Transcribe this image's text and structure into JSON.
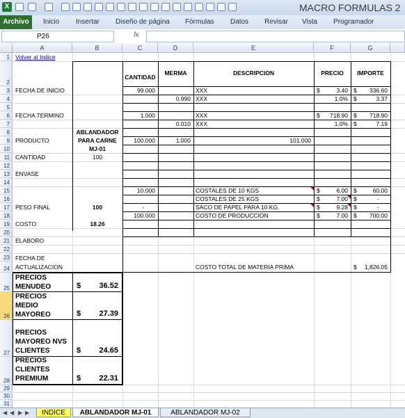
{
  "window": {
    "title": "MACRO FORMULAS 2"
  },
  "ribbon": {
    "tabs": [
      "Archivo",
      "Inicio",
      "Insertar",
      "Diseño de página",
      "Fórmulas",
      "Datos",
      "Revisar",
      "Vista",
      "Programador"
    ]
  },
  "formula_bar": {
    "name_box": "P26",
    "fx": "fx",
    "content": ""
  },
  "columns": [
    "A",
    "B",
    "C",
    "D",
    "E",
    "F",
    "G"
  ],
  "rows": [
    "1",
    "2",
    "3",
    "4",
    "5",
    "6",
    "7",
    "8",
    "9",
    "10",
    "11",
    "12",
    "13",
    "14",
    "15",
    "16",
    "17",
    "18",
    "19",
    "20",
    "21",
    "22",
    "23",
    "24",
    "25",
    "26",
    "27",
    "28",
    "29",
    "30",
    "31"
  ],
  "sheet": {
    "link": "Volver al Indice",
    "headers": {
      "cantidad": "CANTIDAD",
      "merma": "MERMA",
      "descripcion": "DESCRIPCION",
      "precio": "PRECIO",
      "importe": "IMPORTE"
    },
    "labels": {
      "fecha_inicio": "FECHA DE INICIO",
      "fecha_termino": "FECHA  TERMINO",
      "producto": "PRODUCTO",
      "cantidad": "CANTIDAD",
      "envase": "ENVASE",
      "peso_final": "PESO FINAL",
      "costo": "COSTO",
      "elaboro": "ELABORO",
      "fecha_de": "FECHA DE",
      "actualizacion": "ACTUALIZACION"
    },
    "producto_name_1": "ABLANDADOR",
    "producto_name_2": "PARA CARNE",
    "producto_code": "MJ-01",
    "cantidad_val": "100",
    "peso_final_val": "100",
    "costo_val": "18.26",
    "r3": {
      "c": "99.000",
      "e": "XXX",
      "f_sym": "$",
      "f": "3.40",
      "g_sym": "$",
      "g": "336.60"
    },
    "r4": {
      "d": "0.990",
      "e": "XXX",
      "f": "1.0%",
      "g_sym": "$",
      "g": "3.37"
    },
    "r6": {
      "c": "1.000",
      "e": "XXX",
      "f_sym": "$",
      "f": "718.90",
      "g_sym": "$",
      "g": "718.90"
    },
    "r7": {
      "d": "0.010",
      "e": "XXX",
      "f": "1.0%",
      "g_sym": "$",
      "g": "7.19"
    },
    "r9": {
      "c": "100.000",
      "d": "1.000",
      "e": "101.000"
    },
    "r15": {
      "c": "10.000",
      "e": "COSTALES DE 10 KGS",
      "f_sym": "$",
      "f": "6.00",
      "g_sym": "$",
      "g": "60.00"
    },
    "r16": {
      "e": "COSTALES DE 25 KGS",
      "f_sym": "$",
      "f": "7.00",
      "g_sym": "$",
      "g": "-"
    },
    "r17": {
      "c": "-",
      "e": "SACO DE PAPEL PARA 10 KG.",
      "f_sym": "$",
      "f": "9.28",
      "g_sym": "$",
      "g": "-"
    },
    "r18": {
      "c": "100.000",
      "e": "COSTO DE PRODUCCION",
      "f_sym": "$",
      "f": "7.00",
      "g_sym": "$",
      "g": "700.00"
    },
    "r24": {
      "e": "COSTO TOTAL DE MATERIA PRIMA",
      "g_sym": "$",
      "g": "1,826.05"
    },
    "prices": [
      {
        "label_1": "PRECIOS",
        "label_2": "MENUDEO",
        "label_3": "",
        "label_4": "",
        "sym": "$",
        "value": "36.52"
      },
      {
        "label_1": "PRECIOS",
        "label_2": "MEDIO",
        "label_3": "MAYOREO",
        "label_4": "",
        "sym": "$",
        "value": "27.39"
      },
      {
        "label_1": "PRECIOS",
        "label_2": "MAYOREO NVS",
        "label_3": "CLIENTES",
        "label_4": "",
        "sym": "$",
        "value": "24.65"
      },
      {
        "label_1": "PRECIOS",
        "label_2": "CLIENTES",
        "label_3": "PREMIUM",
        "label_4": "",
        "sym": "$",
        "value": "22.31"
      }
    ]
  },
  "sheet_tabs": [
    "INDICE",
    "ABLANDADOR MJ-01",
    "ABLANDADOR MJ-02"
  ],
  "colors": {
    "file_tab": "#2f6f2f",
    "indice_tab": "#ffff66",
    "selected_row": "#f7d97b"
  }
}
